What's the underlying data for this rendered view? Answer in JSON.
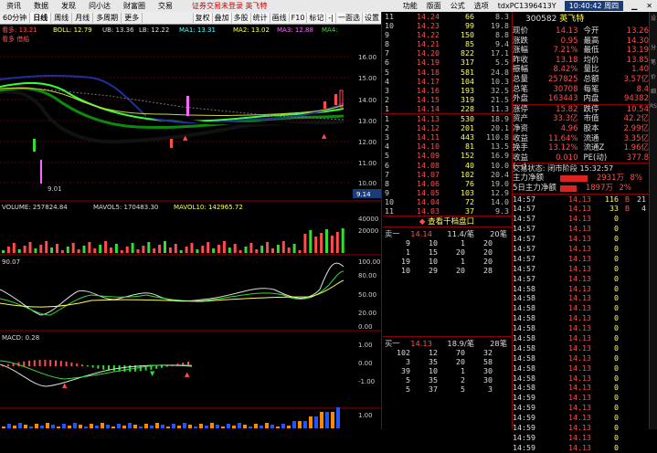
{
  "menu": {
    "items": [
      "资讯",
      "数据",
      "发现",
      "问小达",
      "财富圈",
      "交易"
    ],
    "stock_title": "证券交易未登录 英飞特",
    "right_items": [
      "功能",
      "版面",
      "公式",
      "选项"
    ],
    "account": "tdxPC1396413Y",
    "clock": "10:40:42 周四"
  },
  "tabs": {
    "items": [
      "60分钟",
      "日线",
      "周线",
      "月线",
      "多周期",
      "更多"
    ],
    "active": 1,
    "right": [
      "复权",
      "叠加",
      "多股",
      "统计",
      "画线",
      "F10",
      "标记",
      "-|",
      "一面选",
      "设置"
    ]
  },
  "indicators": {
    "line": "看多: 13.21",
    "boll": "BOLL: 12.79",
    "ub": "UB: 13.36",
    "lb": "LB: 12.22",
    "ma1": "MA1: 13.31",
    "ma2": "MA2: 13.02",
    "ma3": "MA3: 12.88",
    "ma4": "MA4:",
    "signal": "看多 借船",
    "price_axis": [
      "16.00",
      "15.00",
      "14.00",
      "13.00",
      "12.00",
      "11.00",
      "10.00"
    ],
    "last_price": "9.14",
    "low_label": "9.01"
  },
  "volume": {
    "label": "VOLUME: 257824.84",
    "mavol5": "MAVOL5: 170483.30",
    "mavol10": "MAVOL10: 142965.72",
    "axis": [
      "40000",
      "20000"
    ],
    "markers": [
      "3 1",
      "3 1",
      "3 1",
      "3",
      "3",
      "3",
      "3",
      "3",
      "3 1"
    ]
  },
  "kd": {
    "label": "90.07",
    "axis": [
      "100.00",
      "80.00",
      "50.00",
      "20.00",
      "0.00"
    ]
  },
  "macd": {
    "label": "MACD: 0.28",
    "axis": [
      "1.00",
      "0.00",
      "-1.00"
    ]
  },
  "bottom": {
    "axis": "1.00"
  },
  "orderbook_top": [
    [
      "11",
      "14.24",
      "66",
      "8.3"
    ],
    [
      "10",
      "14.23",
      "99",
      "19.8"
    ],
    [
      "9",
      "14.22",
      "150",
      "8.8"
    ],
    [
      "8",
      "14.21",
      "85",
      "9.4"
    ],
    [
      "7",
      "14.20",
      "822",
      "17.1"
    ],
    [
      "6",
      "14.19",
      "317",
      "5.5"
    ],
    [
      "5",
      "14.18",
      "581",
      "24.8"
    ],
    [
      "4",
      "14.17",
      "104",
      "10.3"
    ],
    [
      "3",
      "14.16",
      "193",
      "32.5"
    ],
    [
      "2",
      "14.15",
      "319",
      "21.5"
    ],
    [
      "1",
      "14.14",
      "228",
      "11.3"
    ]
  ],
  "orderbook_bottom": [
    [
      "1",
      "14.13",
      "530",
      "18.9"
    ],
    [
      "2",
      "14.12",
      "201",
      "20.1"
    ],
    [
      "3",
      "14.11",
      "443",
      "110.8"
    ],
    [
      "4",
      "14.10",
      "81",
      "13.5"
    ],
    [
      "5",
      "14.09",
      "152",
      "16.9"
    ],
    [
      "6",
      "14.08",
      "40",
      "10.0"
    ],
    [
      "7",
      "14.07",
      "102",
      "20.4"
    ],
    [
      "8",
      "14.06",
      "76",
      "19.0"
    ],
    [
      "9",
      "14.05",
      "103",
      "12.9"
    ],
    [
      "10",
      "14.04",
      "72",
      "14.0"
    ],
    [
      "11",
      "14.03",
      "37",
      "9.3"
    ]
  ],
  "orderbook_link": "查看千档盘口",
  "sell_queue": {
    "label": "卖一",
    "price": "14.14",
    "detail": "11.4/笔",
    "count": "20笔",
    "rows": [
      [
        "9",
        "10",
        "1",
        "20"
      ],
      [
        "1",
        "15",
        "20",
        "20"
      ],
      [
        "19",
        "10",
        "1",
        "20"
      ],
      [
        "10",
        "29",
        "20",
        "28"
      ]
    ]
  },
  "buy_queue": {
    "label": "买一",
    "price": "14.13",
    "detail": "18.9/笔",
    "count": "28笔",
    "rows": [
      [
        "102",
        "12",
        "70",
        "32"
      ],
      [
        "3",
        "35",
        "20",
        "58"
      ],
      [
        "39",
        "10",
        "1",
        "30"
      ],
      [
        "5",
        "35",
        "2",
        "30"
      ],
      [
        "5",
        "37",
        "5",
        "3"
      ]
    ]
  },
  "quote": {
    "code": "300582",
    "name": "英飞特",
    "rows": [
      [
        "现价",
        "14.13",
        "今开",
        "13.26"
      ],
      [
        "涨跌",
        "0.95",
        "最高",
        "14.30"
      ],
      [
        "涨幅",
        "7.21%",
        "最低",
        "13.19"
      ],
      [
        "昨收",
        "13.18",
        "均价",
        "13.85"
      ],
      [
        "振幅",
        "8.42%",
        "量比",
        "1.40"
      ],
      [
        "总量",
        "257825",
        "总额",
        "3.57亿"
      ],
      [
        "总笔",
        "30708",
        "每笔",
        "8.4"
      ],
      [
        "外盘",
        "163443",
        "内盘",
        "94382"
      ]
    ],
    "rows2": [
      [
        "涨停",
        "15.82",
        "跌停",
        "10.54"
      ],
      [
        "资产",
        "33.3亿",
        "市值",
        "42.2亿"
      ],
      [
        "净资",
        "4.96",
        "股本",
        "2.99亿"
      ],
      [
        "收益",
        "11.64%",
        "流通",
        "3.35亿"
      ],
      [
        "换手",
        "13.12%",
        "流通Z",
        "1.96亿"
      ],
      [
        "收益(一)",
        "0.010",
        "PE(动)",
        "377.8"
      ]
    ],
    "trade_status": "交易状态: 闭市阶段 15:32:57",
    "flow": [
      [
        "主力净额",
        "2931万",
        "8%"
      ],
      [
        "5日主力净额",
        "1897万",
        "2%"
      ]
    ]
  },
  "ticks": [
    [
      "14:57",
      "14.13",
      "116",
      "B",
      "21"
    ],
    [
      "14:57",
      "14.13",
      "33",
      "B",
      "4"
    ],
    [
      "14:57",
      "14.13",
      "0",
      "",
      ""
    ],
    [
      "14:57",
      "14.13",
      "0",
      "",
      ""
    ],
    [
      "14:57",
      "14.13",
      "0",
      "",
      ""
    ],
    [
      "14:57",
      "14.13",
      "0",
      "",
      ""
    ],
    [
      "14:57",
      "14.13",
      "0",
      "",
      ""
    ],
    [
      "14:57",
      "14.13",
      "0",
      "",
      ""
    ],
    [
      "14:57",
      "14.13",
      "0",
      "",
      ""
    ],
    [
      "14:58",
      "14.13",
      "0",
      "",
      ""
    ],
    [
      "14:58",
      "14.13",
      "0",
      "",
      ""
    ],
    [
      "14:58",
      "14.13",
      "0",
      "",
      ""
    ],
    [
      "14:58",
      "14.13",
      "0",
      "",
      ""
    ],
    [
      "14:58",
      "14.13",
      "0",
      "",
      ""
    ],
    [
      "14:58",
      "14.13",
      "0",
      "",
      ""
    ],
    [
      "14:58",
      "14.13",
      "0",
      "",
      ""
    ],
    [
      "14:58",
      "14.13",
      "0",
      "",
      ""
    ],
    [
      "14:58",
      "14.13",
      "0",
      "",
      ""
    ],
    [
      "14:58",
      "14.13",
      "0",
      "",
      ""
    ],
    [
      "14:58",
      "14.13",
      "0",
      "",
      ""
    ],
    [
      "14:59",
      "14.13",
      "0",
      "",
      ""
    ],
    [
      "14:59",
      "14.13",
      "0",
      "",
      ""
    ],
    [
      "14:59",
      "14.13",
      "0",
      "",
      ""
    ],
    [
      "14:59",
      "14.13",
      "0",
      "",
      ""
    ],
    [
      "14:59",
      "14.13",
      "0",
      "",
      ""
    ],
    [
      "14:59",
      "14.13",
      "0",
      "",
      ""
    ]
  ],
  "sidebar": [
    "设",
    "",
    "分",
    "笔",
    "价",
    "细",
    "RSI",
    "",
    "",
    "",
    "",
    ""
  ]
}
